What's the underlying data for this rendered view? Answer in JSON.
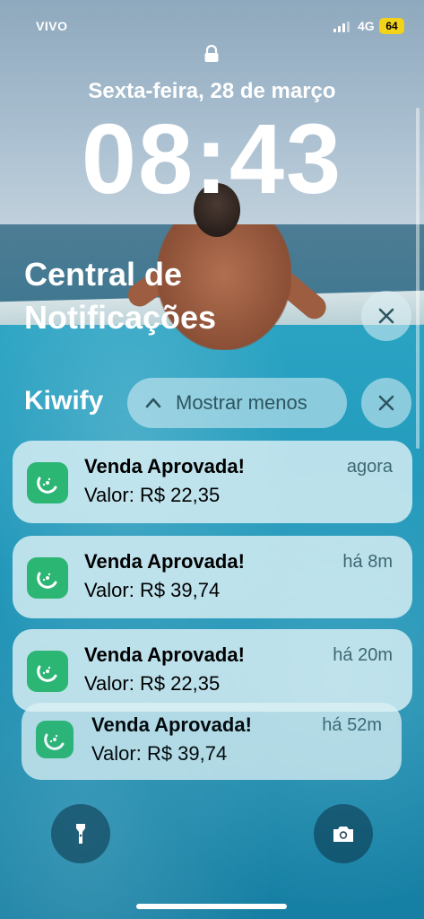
{
  "status_bar": {
    "carrier": "VIVO",
    "network": "4G",
    "battery": "64"
  },
  "lock_screen": {
    "date": "Sexta-feira, 28 de março",
    "time": "08:43"
  },
  "notification_center": {
    "title": "Central de Notificações",
    "close_icon": "close-icon"
  },
  "group": {
    "app_name": "Kiwify",
    "show_less_label": "Mostrar menos",
    "close_icon": "close-icon"
  },
  "notifications": [
    {
      "title": "Venda Aprovada!",
      "body": "Valor: R$ 22,35",
      "time": "agora",
      "icon": "kiwify-app-icon"
    },
    {
      "title": "Venda Aprovada!",
      "body": "Valor: R$ 39,74",
      "time": "há 8m",
      "icon": "kiwify-app-icon"
    },
    {
      "title": "Venda Aprovada!",
      "body": "Valor: R$ 22,35",
      "time": "há 20m",
      "icon": "kiwify-app-icon"
    },
    {
      "title": "Venda Aprovada!",
      "body": "Valor: R$ 39,74",
      "time": "há 52m",
      "icon": "kiwify-app-icon"
    }
  ],
  "quick_actions": {
    "left_icon": "flashlight-icon",
    "right_icon": "camera-icon"
  },
  "colors": {
    "battery": "#f3d21a",
    "app_icon": "#2bb673",
    "notification_bg": "#dcf0f5"
  }
}
